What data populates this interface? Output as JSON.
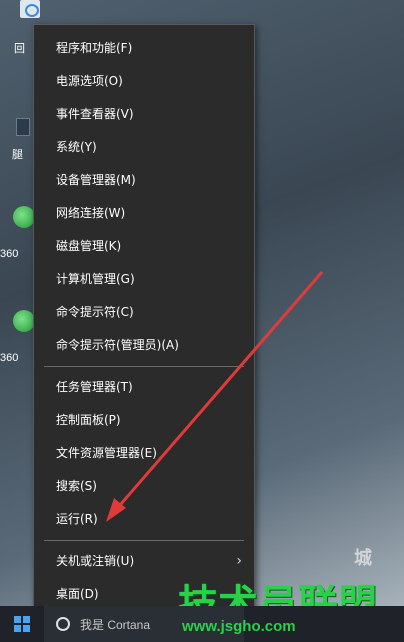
{
  "desktop": {
    "icon_labels": [
      "回",
      "腿",
      "360",
      "360"
    ]
  },
  "context_menu": {
    "items": [
      {
        "label": "程序和功能(F)"
      },
      {
        "label": "电源选项(O)"
      },
      {
        "label": "事件查看器(V)"
      },
      {
        "label": "系统(Y)"
      },
      {
        "label": "设备管理器(M)"
      },
      {
        "label": "网络连接(W)"
      },
      {
        "label": "磁盘管理(K)"
      },
      {
        "label": "计算机管理(G)"
      },
      {
        "label": "命令提示符(C)"
      },
      {
        "label": "命令提示符(管理员)(A)"
      },
      {
        "label": "任务管理器(T)"
      },
      {
        "label": "控制面板(P)"
      },
      {
        "label": "文件资源管理器(E)"
      },
      {
        "label": "搜索(S)"
      },
      {
        "label": "运行(R)"
      },
      {
        "label": "关机或注销(U)",
        "has_submenu": true
      },
      {
        "label": "桌面(D)"
      }
    ]
  },
  "taskbar": {
    "search_placeholder": "我是 Cortana",
    "accent_color": "#4aa3f0"
  },
  "watermark": {
    "main": "技术员联盟",
    "sub": "www.jsgho.com",
    "city": "城",
    "color": "#2ad04a"
  },
  "annotation": {
    "arrow_color": "#e03a3a"
  }
}
